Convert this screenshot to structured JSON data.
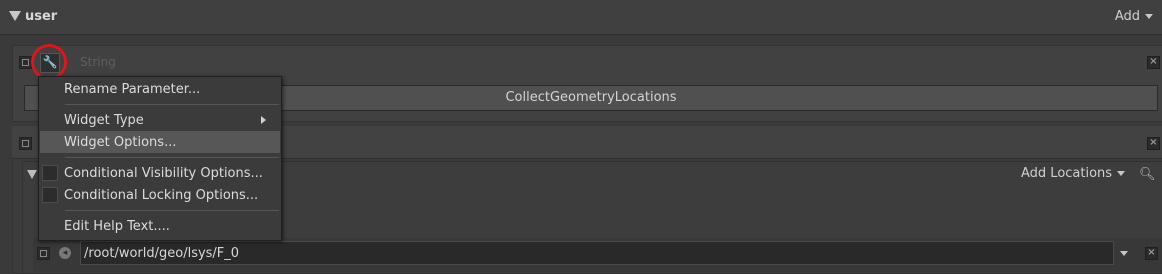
{
  "header": {
    "title": "user",
    "add_label": "Add"
  },
  "panel1": {
    "title_dim": "String",
    "value": "CollectGeometryLocations"
  },
  "panel2": {
    "add_locations_label": "Add Locations",
    "location_path": "/root/world/geo/lsys/F_0"
  },
  "context_menu": {
    "items": [
      {
        "label": "Rename Parameter..."
      },
      {
        "label": "Widget Type"
      },
      {
        "label": "Widget Options..."
      },
      {
        "label": "Conditional Visibility Options..."
      },
      {
        "label": "Conditional Locking Options..."
      },
      {
        "label": "Edit Help Text...."
      }
    ]
  },
  "annotation": {
    "highlight_color": "#e0141c"
  }
}
